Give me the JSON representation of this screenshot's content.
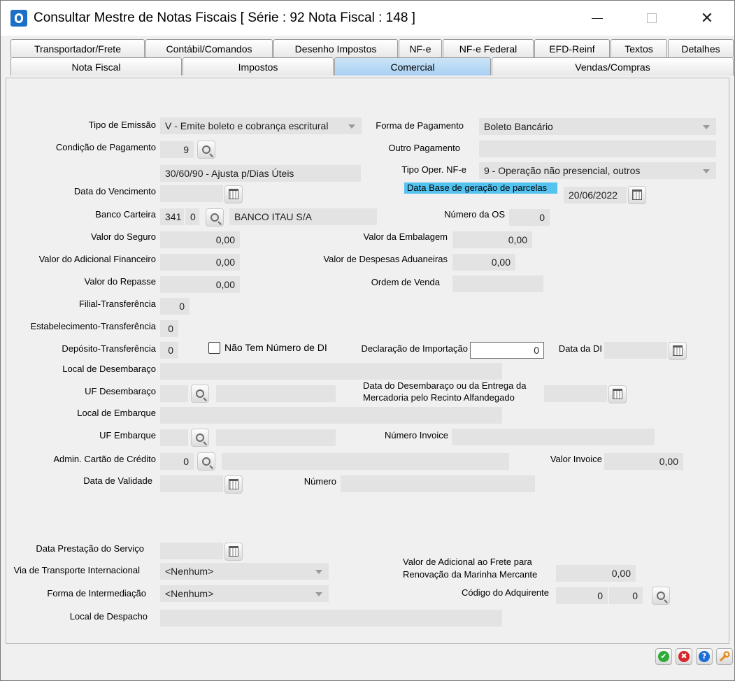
{
  "window": {
    "title": "Consultar Mestre de Notas Fiscais [ Série : 92  Nota Fiscal : 148 ]",
    "minimize": "—",
    "close": "✕"
  },
  "tabs_row1": [
    "Transportador/Frete",
    "Contábil/Comandos",
    "Desenho Impostos",
    "NF-e",
    "NF-e Federal",
    "EFD-Reinf",
    "Textos",
    "Detalhes"
  ],
  "tabs_row2": [
    "Nota Fiscal",
    "Impostos",
    "Comercial",
    "Vendas/Compras"
  ],
  "active_tab": "Comercial",
  "form": {
    "tipo_emissao": {
      "label": "Tipo de Emissão",
      "value": "V - Emite boleto e cobrança escritural"
    },
    "forma_pagamento": {
      "label": "Forma de Pagamento",
      "value": "Boleto Bancário"
    },
    "condicao_pagamento": {
      "label": "Condição de Pagamento",
      "value": "9",
      "desc": "30/60/90 - Ajusta p/Dias Úteis"
    },
    "outro_pagamento": {
      "label": "Outro Pagamento",
      "value": ""
    },
    "tipo_oper_nfe": {
      "label": "Tipo Oper. NF-e",
      "value": "9 - Operação não presencial, outros"
    },
    "data_vencimento": {
      "label": "Data do Vencimento",
      "value": ""
    },
    "data_base_parcelas": {
      "label": "Data Base de geração de parcelas",
      "value": "20/06/2022"
    },
    "banco_carteira": {
      "label": "Banco Carteira",
      "code": "341",
      "carteira": "0",
      "name": "BANCO ITAU S/A"
    },
    "numero_os": {
      "label": "Número da OS",
      "value": "0"
    },
    "valor_seguro": {
      "label": "Valor do Seguro",
      "value": "0,00"
    },
    "valor_embalagem": {
      "label": "Valor da Embalagem",
      "value": "0,00"
    },
    "valor_adicional_financeiro": {
      "label": "Valor do Adicional Financeiro",
      "value": "0,00"
    },
    "valor_despesas_aduaneiras": {
      "label": "Valor de Despesas Aduaneiras",
      "value": "0,00"
    },
    "valor_repasse": {
      "label": "Valor do Repasse",
      "value": "0,00"
    },
    "ordem_venda": {
      "label": "Ordem de Venda",
      "value": ""
    },
    "filial_transferencia": {
      "label": "Filial-Transferência",
      "value": "0"
    },
    "estabelecimento_transferencia": {
      "label": "Estabelecimento-Transferência",
      "value": "0"
    },
    "deposito_transferencia": {
      "label": "Depósito-Transferência",
      "value": "0"
    },
    "nao_tem_numero_di": {
      "label": "Não Tem Número de DI",
      "checked": false
    },
    "declaracao_importacao": {
      "label": "Declaração de Importação",
      "value": "0"
    },
    "data_di": {
      "label": "Data da DI",
      "value": ""
    },
    "local_desembaraco": {
      "label": "Local de Desembaraço",
      "value": ""
    },
    "uf_desembaraco": {
      "label": "UF Desembaraço",
      "value": "",
      "desc": ""
    },
    "data_desembaraco": {
      "label_line1": "Data do Desembaraço ou da Entrega da",
      "label_line2": "Mercadoria pelo Recinto Alfandegado",
      "value": ""
    },
    "local_embarque": {
      "label": "Local de Embarque",
      "value": ""
    },
    "uf_embarque": {
      "label": "UF Embarque",
      "value": "",
      "desc": ""
    },
    "numero_invoice": {
      "label": "Número Invoice",
      "value": ""
    },
    "admin_cartao": {
      "label": "Admin. Cartão de Crédito",
      "value": "0",
      "desc": ""
    },
    "valor_invoice": {
      "label": "Valor Invoice",
      "value": "0,00"
    },
    "data_validade": {
      "label": "Data de Validade",
      "value": ""
    },
    "numero": {
      "label": "Número",
      "value": ""
    },
    "data_prestacao": {
      "label": "Data Prestação do Serviço",
      "value": ""
    },
    "via_transporte": {
      "label": "Via de Transporte Internacional",
      "value": "<Nenhum>"
    },
    "valor_adicional_frete": {
      "label_line1": "Valor de Adicional ao Frete para",
      "label_line2": "Renovação da Marinha Mercante",
      "value": "0,00"
    },
    "forma_intermediacao": {
      "label": "Forma de Intermediação",
      "value": "<Nenhum>"
    },
    "codigo_adquirente": {
      "label": "Código do Adquirente",
      "value1": "0",
      "value2": "0"
    },
    "local_despacho": {
      "label": "Local de Despacho",
      "value": ""
    }
  },
  "bottom_buttons": {
    "ok": "✔",
    "cancel": "✖",
    "help": "?"
  },
  "colors": {
    "highlight": "#55c3f0",
    "active_tab": "#a9d0f2",
    "ok": "#2eaa38",
    "cancel": "#d9262a",
    "help": "#1c6ed6",
    "tools": "#e08a1a"
  }
}
